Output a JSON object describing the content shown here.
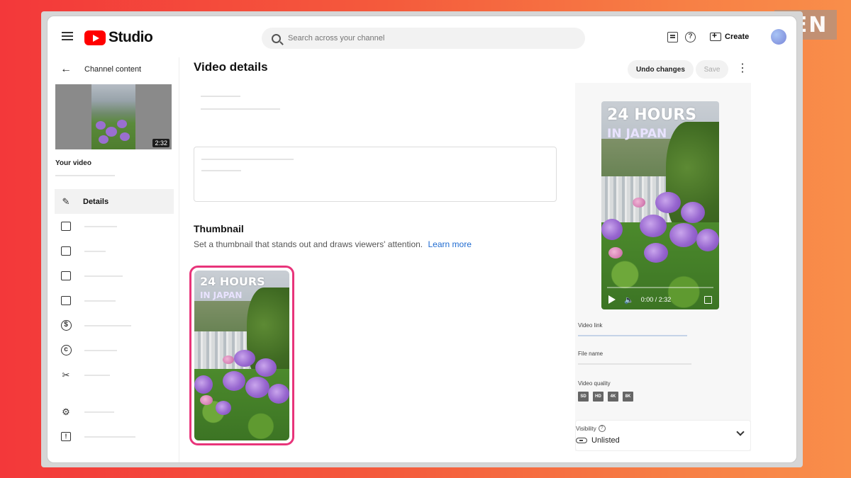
{
  "watermark": "IEN",
  "app": {
    "logo_text": "Studio"
  },
  "search": {
    "placeholder": "Search across your channel"
  },
  "header": {
    "create_label": "Create"
  },
  "sidebar": {
    "back_label": "Channel content",
    "video_duration": "2:32",
    "your_video_label": "Your video",
    "items": [
      {
        "label": "Details",
        "icon": "pencil-icon"
      },
      {
        "label": "",
        "icon": "analytics-icon"
      },
      {
        "label": "",
        "icon": "editor-icon"
      },
      {
        "label": "",
        "icon": "comments-icon"
      },
      {
        "label": "",
        "icon": "subtitles-icon"
      },
      {
        "label": "",
        "icon": "monetization-icon"
      },
      {
        "label": "",
        "icon": "copyright-icon"
      },
      {
        "label": "",
        "icon": "scissors-icon"
      },
      {
        "label": "",
        "icon": "settings-icon"
      },
      {
        "label": "",
        "icon": "feedback-icon"
      }
    ]
  },
  "main": {
    "title": "Video details",
    "undo_label": "Undo changes",
    "save_label": "Save",
    "thumbnail": {
      "title": "Thumbnail",
      "description": "Set a thumbnail that stands out and draws viewers' attention.",
      "learn_more": "Learn more"
    }
  },
  "overlay": {
    "line1": "24 HOURS",
    "line2": "IN JAPAN"
  },
  "preview": {
    "time": "0:00 / 2:32",
    "progress": 0.0
  },
  "right_panel": {
    "video_link_label": "Video link",
    "file_name_label": "File name",
    "video_quality_label": "Video quality",
    "quality_badges": [
      "SD",
      "HD",
      "4K",
      "8K"
    ],
    "visibility_label": "Visibility",
    "visibility_value": "Unlisted"
  },
  "colors": {
    "accent_border": "#e8347a",
    "link": "#1f6bd1",
    "brand": "#ff0000"
  }
}
